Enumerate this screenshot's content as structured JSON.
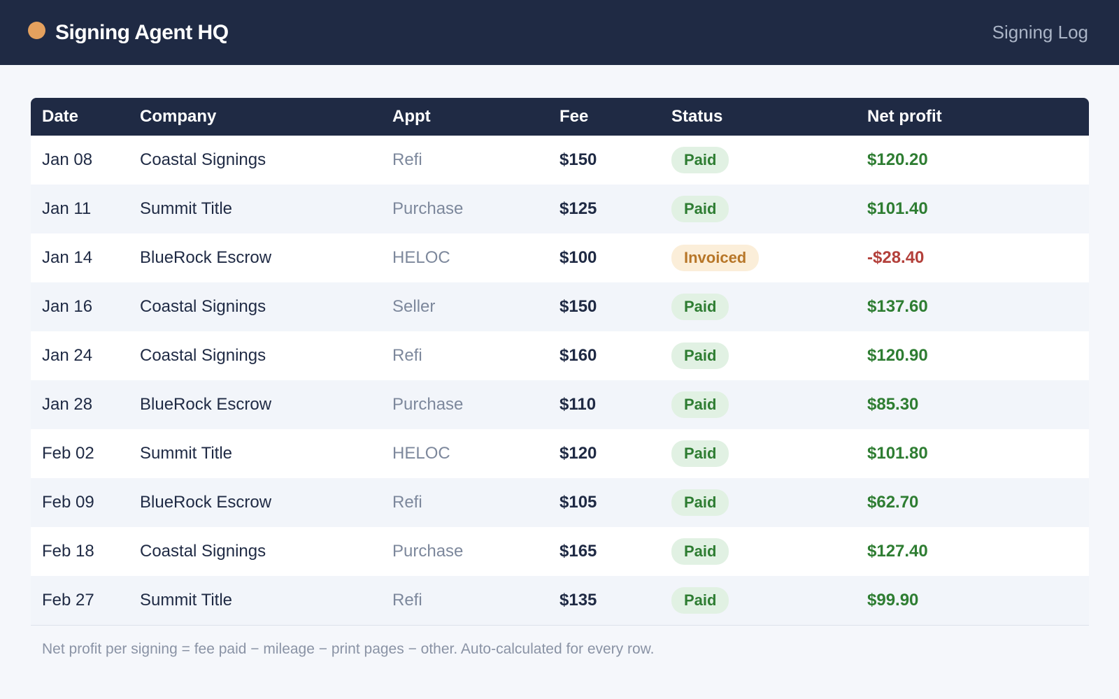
{
  "header": {
    "brand_title": "Signing Agent HQ",
    "nav_link": "Signing Log",
    "brand_dot_color": "#e5a15e"
  },
  "table": {
    "columns": [
      "Date",
      "Company",
      "Appt",
      "Fee",
      "Status",
      "Net profit"
    ],
    "rows": [
      {
        "date": "Jan 08",
        "company": "Coastal Signings",
        "appt": "Refi",
        "fee": "$150",
        "status": "Paid",
        "net": "$120.20"
      },
      {
        "date": "Jan 11",
        "company": "Summit Title",
        "appt": "Purchase",
        "fee": "$125",
        "status": "Paid",
        "net": "$101.40"
      },
      {
        "date": "Jan 14",
        "company": "BlueRock Escrow",
        "appt": "HELOC",
        "fee": "$100",
        "status": "Invoiced",
        "net": "-$28.40"
      },
      {
        "date": "Jan 16",
        "company": "Coastal Signings",
        "appt": "Seller",
        "fee": "$150",
        "status": "Paid",
        "net": "$137.60"
      },
      {
        "date": "Jan 24",
        "company": "Coastal Signings",
        "appt": "Refi",
        "fee": "$160",
        "status": "Paid",
        "net": "$120.90"
      },
      {
        "date": "Jan 28",
        "company": "BlueRock Escrow",
        "appt": "Purchase",
        "fee": "$110",
        "status": "Paid",
        "net": "$85.30"
      },
      {
        "date": "Feb 02",
        "company": "Summit Title",
        "appt": "HELOC",
        "fee": "$120",
        "status": "Paid",
        "net": "$101.80"
      },
      {
        "date": "Feb 09",
        "company": "BlueRock Escrow",
        "appt": "Refi",
        "fee": "$105",
        "status": "Paid",
        "net": "$62.70"
      },
      {
        "date": "Feb 18",
        "company": "Coastal Signings",
        "appt": "Purchase",
        "fee": "$165",
        "status": "Paid",
        "net": "$127.40"
      },
      {
        "date": "Feb 27",
        "company": "Summit Title",
        "appt": "Refi",
        "fee": "$135",
        "status": "Paid",
        "net": "$99.90"
      }
    ]
  },
  "footnote": "Net profit per signing = fee paid − mileage − print pages − other.  Auto-calculated for every row.",
  "colors": {
    "header_bg": "#1f2a44",
    "positive": "#2e7d32",
    "negative": "#b3403b",
    "paid_badge_bg": "#e1f1e3",
    "invoiced_badge_bg": "#fbeed9"
  }
}
